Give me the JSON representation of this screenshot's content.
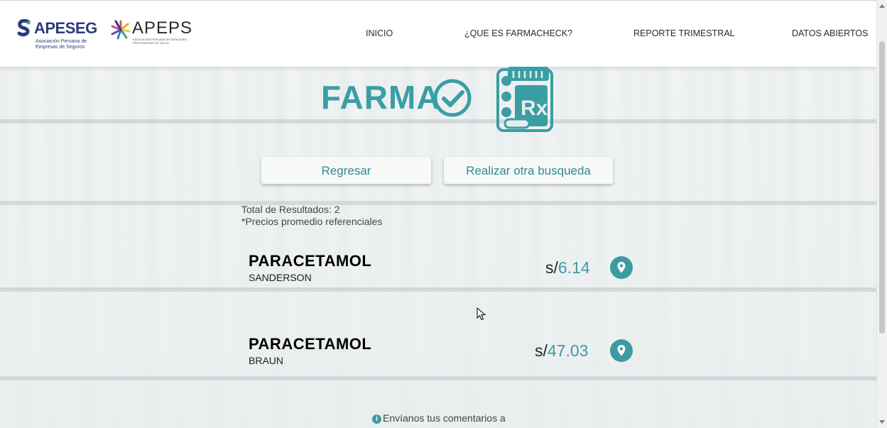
{
  "header": {
    "apeseg": {
      "name": "APESEG",
      "subtitle": "Asociación Peruana de Empresas de Seguros"
    },
    "apeps": {
      "name": "APEPS",
      "subtitle": "ASOCIACIÓN PERUANA DE ENTIDADES PRESTADORAS DE SALUD"
    },
    "nav": [
      {
        "label": "INICIO"
      },
      {
        "label": "¿QUE ES FARMACHECK?"
      },
      {
        "label": "REPORTE TRIMESTRAL"
      },
      {
        "label": "DATOS ABIERTOS"
      }
    ]
  },
  "brand": {
    "word": "FARMA",
    "color": "#3a9ea5"
  },
  "actions": {
    "back_label": "Regresar",
    "new_search_label": "Realizar otra busqueda"
  },
  "results_meta": {
    "total_label": "Total de Resultados: 2",
    "note": "*Precios promedio referenciales"
  },
  "results": [
    {
      "name": "PARACETAMOL",
      "lab": "SANDERSON",
      "currency": "s/",
      "price": "6.14",
      "icon": "map-pin-icon"
    },
    {
      "name": "PARACETAMOL",
      "lab": "BRAUN",
      "currency": "s/",
      "price": "47.03",
      "icon": "map-pin-icon"
    }
  ],
  "footer": {
    "info_icon": "i",
    "text": "Envíanos tus comentarios a"
  },
  "colors": {
    "accent": "#3e9aa1",
    "apeseg_blue": "#2b3d80"
  }
}
